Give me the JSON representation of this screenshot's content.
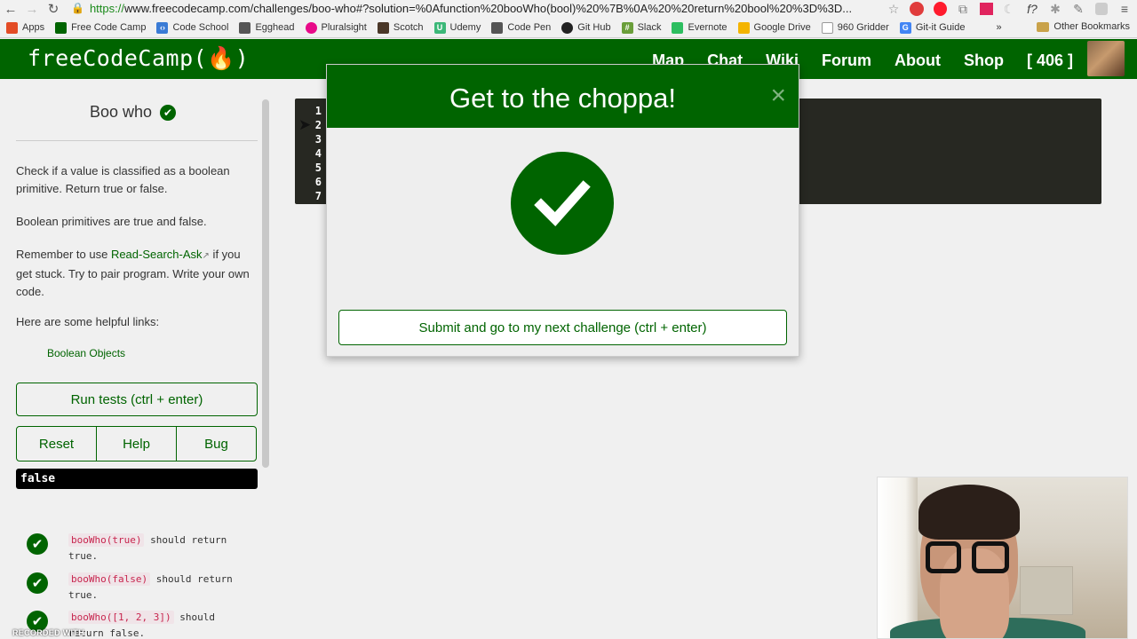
{
  "browser": {
    "url_scheme": "https://",
    "url_rest": "www.freecodecamp.com/challenges/boo-who#?solution=%0Afunction%20booWho(bool)%20%7B%0A%20%20return%20bool%20%3D%3D...",
    "bookmarks": [
      {
        "label": "Apps",
        "icon": "apps-grid-icon",
        "color": "#e34c26"
      },
      {
        "label": "Free Code Camp",
        "icon": "fcc-icon",
        "color": "#006400"
      },
      {
        "label": "Code School",
        "icon": "code-icon",
        "color": "#3a7bd5"
      },
      {
        "label": "Egghead",
        "icon": "egghead-icon",
        "color": "#555555"
      },
      {
        "label": "Pluralsight",
        "icon": "pluralsight-icon",
        "color": "#e80a89"
      },
      {
        "label": "Scotch",
        "icon": "scotch-icon",
        "color": "#4a3728"
      },
      {
        "label": "Udemy",
        "icon": "udemy-icon",
        "color": "#3cb878"
      },
      {
        "label": "Code Pen",
        "icon": "codepen-icon",
        "color": "#555555"
      },
      {
        "label": "Git Hub",
        "icon": "github-icon",
        "color": "#222222"
      },
      {
        "label": "Slack",
        "icon": "slack-icon",
        "color": "#6a9e3a"
      },
      {
        "label": "Evernote",
        "icon": "evernote-icon",
        "color": "#2dbe60"
      },
      {
        "label": "Google Drive",
        "icon": "gdrive-icon",
        "color": "#f4b400"
      },
      {
        "label": "960 Gridder",
        "icon": "doc-icon",
        "color": "#999999"
      },
      {
        "label": "Git-it Guide",
        "icon": "google-icon",
        "color": "#4285f4"
      }
    ],
    "more_label": "»",
    "other_bookmarks": "Other Bookmarks"
  },
  "fcc_nav": {
    "logo": "freeCodeCamp(🔥)",
    "links": [
      "Map",
      "Chat",
      "Wiki",
      "Forum",
      "About",
      "Shop",
      "[ 406 ]"
    ]
  },
  "challenge": {
    "title": "Boo who",
    "p1": "Check if a value is classified as a boolean primitive. Return true or false.",
    "p2": "Boolean primitives are true and false.",
    "p3_a": "Remember to use ",
    "p3_link": "Read-Search-Ask",
    "p3_b": " if you get stuck. Try to pair program. Write your own code.",
    "p4": "Here are some helpful links:",
    "link_boolean": "Boolean Objects",
    "run_label": "Run tests (ctrl + enter)",
    "reset_label": "Reset",
    "help_label": "Help",
    "bug_label": "Bug",
    "output": "false",
    "tests": [
      {
        "code": "booWho(true)",
        "rest": " should return true."
      },
      {
        "code": "booWho(false)",
        "rest": " should return true."
      },
      {
        "code": "booWho([1, 2, 3])",
        "rest": " should return false."
      }
    ]
  },
  "editor": {
    "line_numbers": [
      "1",
      "2",
      "3",
      "4",
      "5",
      "6",
      "7"
    ]
  },
  "modal": {
    "title": "Get to the choppa!",
    "close": "×",
    "submit_label": "Submit and go to my next challenge (ctrl + enter)"
  },
  "watermark": "RECORDED WITH",
  "colors": {
    "brand_green": "#006400",
    "editor_bg": "#272822"
  }
}
